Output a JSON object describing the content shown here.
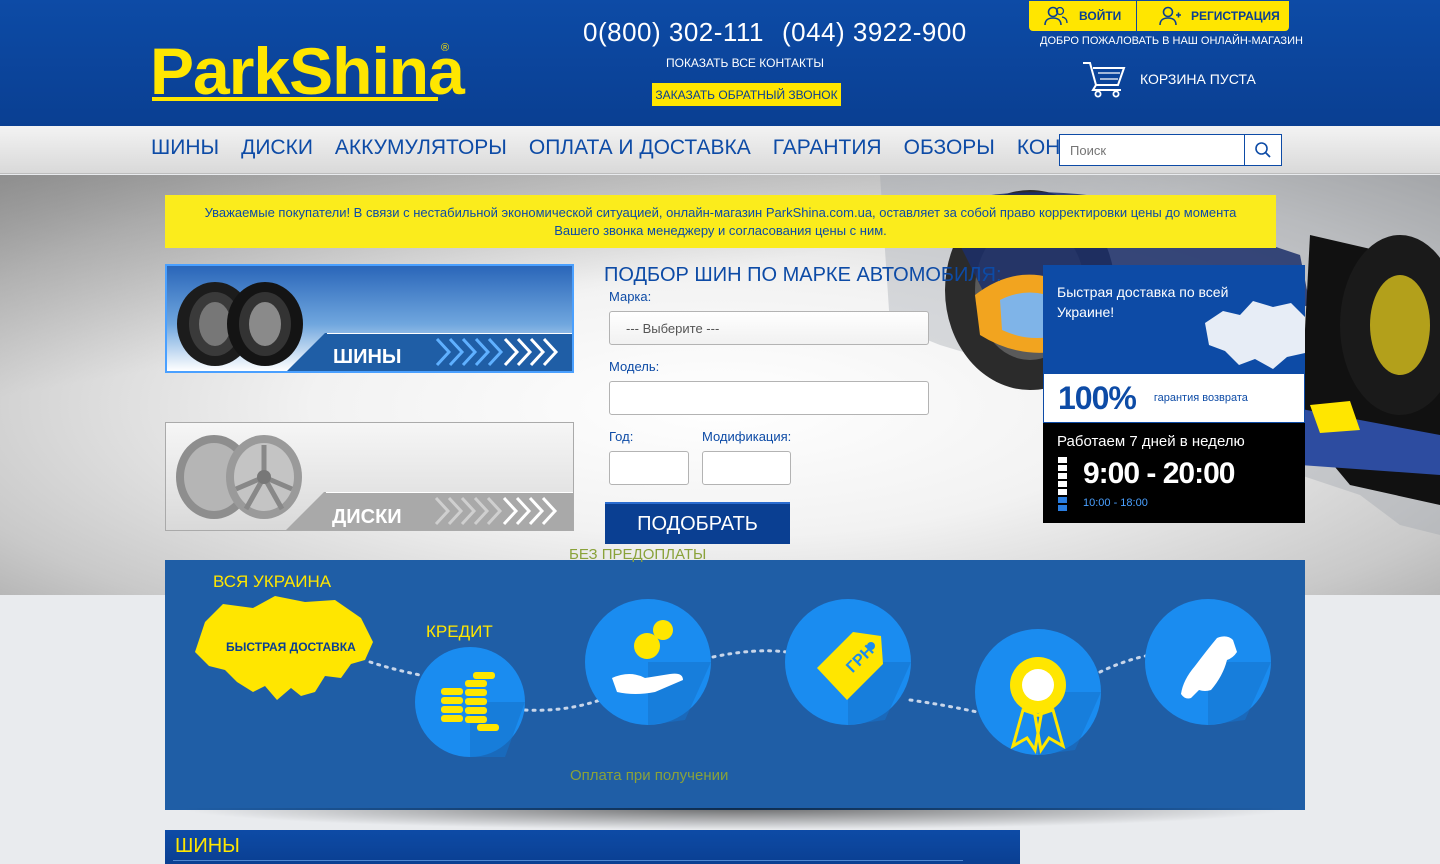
{
  "header": {
    "logo": "ParkShina",
    "logo_reg": "®",
    "phone1": "0(800) 302-111",
    "phone2": "(044) 3922-900",
    "all_contacts": "ПОКАЗАТЬ ВСЕ КОНТАКТЫ",
    "callback": "ЗАКАЗАТЬ ОБРАТНЫЙ ЗВОНОК",
    "login": "ВОЙТИ",
    "register": "РЕГИСТРАЦИЯ",
    "welcome": "ДОБРО ПОЖАЛОВАТЬ В НАШ ОНЛАЙН-МАГАЗИН",
    "cart": "КОРЗИНА ПУСТА"
  },
  "nav": {
    "items": [
      "ШИНЫ",
      "ДИСКИ",
      "АККУМУЛЯТОРЫ",
      "ОПЛАТА И ДОСТАВКА",
      "ГАРАНТИЯ",
      "ОБЗОРЫ",
      "КОНТАКТЫ"
    ]
  },
  "search": {
    "placeholder": "Поиск"
  },
  "notice": "Уважаемые покупатели! В связи с нестабильной экономической ситуацией, онлайн-магазин ParkShina.com.ua, оставляет за собой право корректировки цены до момента Вашего звонка менеджеру и согласования цены с ним.",
  "categories": {
    "tires": "ШИНЫ",
    "wheels": "ДИСКИ"
  },
  "selector": {
    "title": "ПОДБОР ШИН ПО МАРКЕ АВТОМОБИЛЯ:",
    "brand_label": "Марка:",
    "brand_value": "--- Выберите ---",
    "model_label": "Модель:",
    "year_label": "Год:",
    "mod_label": "Модификация:",
    "submit": "ПОДОБРАТЬ"
  },
  "promo": {
    "delivery": "Быстрая доставка по всей Украине!",
    "percent": "100%",
    "guarantee": "гарантия возврата",
    "days": "Работаем 7 дней в неделю",
    "hours_weekdays": "9:00 - 20:00",
    "hours_weekend": "10:00 - 18:00"
  },
  "features": {
    "ukraine": "ВСЯ УКРАИНА",
    "fast_delivery": "БЫСТРАЯ ДОСТАВКА",
    "credit": "КРЕДИТ",
    "no_prepay": "БЕЗ ПРЕДОПЛАТЫ",
    "pay_on_receipt": "Оплата при получении",
    "currency": "ГРН"
  },
  "section": {
    "tires": "ШИНЫ"
  },
  "colors": {
    "brand_blue": "#0d4ba6",
    "brand_yellow": "#ffe600",
    "feature_blue": "#1f5ea6",
    "circle_blue": "#1a8cf0"
  }
}
